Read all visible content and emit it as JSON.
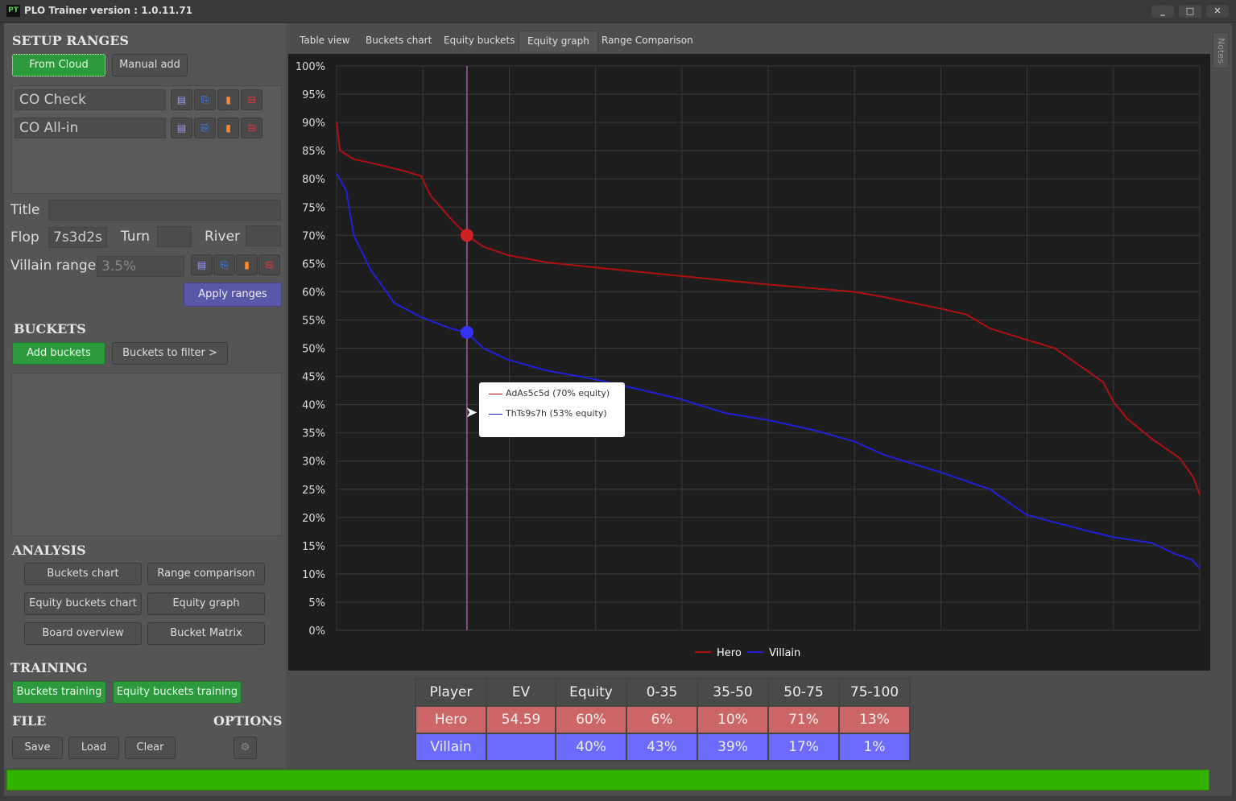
{
  "window": {
    "logo": "PT",
    "title": "PLO Trainer version : 1.0.11.71",
    "minimize": "_",
    "maximize": "□",
    "close": "✕"
  },
  "setup": {
    "heading": "SETUP RANGES",
    "from_cloud": "From Cloud",
    "manual_add": "Manual add",
    "ranges": [
      {
        "name": "CO Check"
      },
      {
        "name": "CO All-in"
      }
    ],
    "title_label": "Title",
    "title_value": "",
    "flop_label": "Flop",
    "flop_value": "7s3d2s",
    "turn_label": "Turn",
    "turn_value": "",
    "river_label": "River",
    "river_value": "",
    "villain_label": "Villain range",
    "villain_value": "3.5%",
    "apply": "Apply ranges"
  },
  "buckets": {
    "heading": "BUCKETS",
    "add": "Add buckets",
    "filter": "Buckets to filter >"
  },
  "analysis": {
    "heading": "ANALYSIS",
    "buttons": [
      "Buckets chart",
      "Range comparison",
      "Equity buckets chart",
      "Equity graph",
      "Board overview",
      "Bucket Matrix"
    ]
  },
  "training": {
    "heading": "TRAINING",
    "buttons": [
      "Buckets training",
      "Equity buckets training"
    ]
  },
  "file": {
    "heading": "FILE",
    "save": "Save",
    "load": "Load",
    "clear": "Clear"
  },
  "options": {
    "heading": "OPTIONS",
    "icon": "gear-icon"
  },
  "tabs": [
    {
      "label": "Table view"
    },
    {
      "label": "Buckets chart"
    },
    {
      "label": "Equity buckets"
    },
    {
      "label": "Equity graph",
      "active": true
    },
    {
      "label": "Range Comparison"
    }
  ],
  "notes": "Notes",
  "progress": {
    "value": 100,
    "color": "#33b300"
  },
  "tooltip": {
    "items": [
      {
        "text": "AdAs5c5d (70% equity)",
        "color": "#b01010"
      },
      {
        "text": "ThTs9s7h (53% equity)",
        "color": "#2020d0"
      }
    ]
  },
  "chart_data": {
    "type": "line",
    "title": "",
    "xlabel": "",
    "ylabel": "",
    "xlim": [
      0,
      100
    ],
    "ylim": [
      0,
      100
    ],
    "grid": true,
    "legend": "bottom-center",
    "yticks": [
      "0%",
      "5%",
      "10%",
      "15%",
      "20%",
      "25%",
      "30%",
      "35%",
      "40%",
      "45%",
      "50%",
      "55%",
      "60%",
      "65%",
      "70%",
      "75%",
      "80%",
      "85%",
      "90%",
      "95%",
      "100%"
    ],
    "cursor_x": 15.1,
    "series": [
      {
        "name": "Hero",
        "color": "#b01010",
        "points": [
          [
            0,
            90
          ],
          [
            0.4,
            85
          ],
          [
            2,
            83.5
          ],
          [
            4.9,
            82.5
          ],
          [
            7.6,
            81.5
          ],
          [
            9.8,
            80.5
          ],
          [
            10.9,
            77
          ],
          [
            13.2,
            73
          ],
          [
            15.1,
            70
          ],
          [
            17,
            68
          ],
          [
            19.8,
            66.5
          ],
          [
            24.4,
            65.2
          ],
          [
            30,
            64.3
          ],
          [
            39.8,
            62.8
          ],
          [
            49.8,
            61.3
          ],
          [
            59.9,
            60
          ],
          [
            63.6,
            59
          ],
          [
            70,
            57
          ],
          [
            72.9,
            56
          ],
          [
            75.7,
            53.5
          ],
          [
            79.9,
            51.5
          ],
          [
            83.2,
            50
          ],
          [
            86,
            47
          ],
          [
            88.8,
            44
          ],
          [
            90,
            40.5
          ],
          [
            91.6,
            37.5
          ],
          [
            94.4,
            34
          ],
          [
            97.7,
            30.5
          ],
          [
            99.3,
            27
          ],
          [
            100,
            24
          ]
        ],
        "highlight": [
          15.1,
          70
        ]
      },
      {
        "name": "Villain",
        "color": "#2020d8",
        "points": [
          [
            0,
            81
          ],
          [
            1.1,
            78
          ],
          [
            2,
            70
          ],
          [
            3.9,
            64
          ],
          [
            6.7,
            58
          ],
          [
            9.8,
            55.5
          ],
          [
            13.2,
            53.5
          ],
          [
            15.1,
            52.8
          ],
          [
            17,
            50
          ],
          [
            19.8,
            48
          ],
          [
            24.4,
            46
          ],
          [
            29.9,
            44.5
          ],
          [
            35.6,
            42.5
          ],
          [
            39.8,
            41
          ],
          [
            45,
            38.5
          ],
          [
            49.8,
            37.3
          ],
          [
            55.2,
            35.5
          ],
          [
            59.9,
            33.5
          ],
          [
            63.6,
            31
          ],
          [
            70,
            28
          ],
          [
            75.7,
            25
          ],
          [
            79.9,
            20.5
          ],
          [
            82.3,
            19.5
          ],
          [
            86,
            18
          ],
          [
            90,
            16.5
          ],
          [
            94.4,
            15.5
          ],
          [
            97.2,
            13.5
          ],
          [
            99.1,
            12.5
          ],
          [
            100,
            11
          ]
        ],
        "highlight": [
          15.1,
          52.8
        ]
      }
    ]
  },
  "stats": {
    "headers": [
      "Player",
      "EV",
      "Equity",
      "0-35",
      "35-50",
      "50-75",
      "75-100"
    ],
    "rows": [
      {
        "color": "#cc6666",
        "cells": [
          "Hero",
          "54.59",
          "60%",
          "6%",
          "10%",
          "71%",
          "13%"
        ]
      },
      {
        "color": "#6b6bff",
        "cells": [
          "Villain",
          "",
          "40%",
          "43%",
          "39%",
          "17%",
          "1%"
        ]
      }
    ]
  }
}
